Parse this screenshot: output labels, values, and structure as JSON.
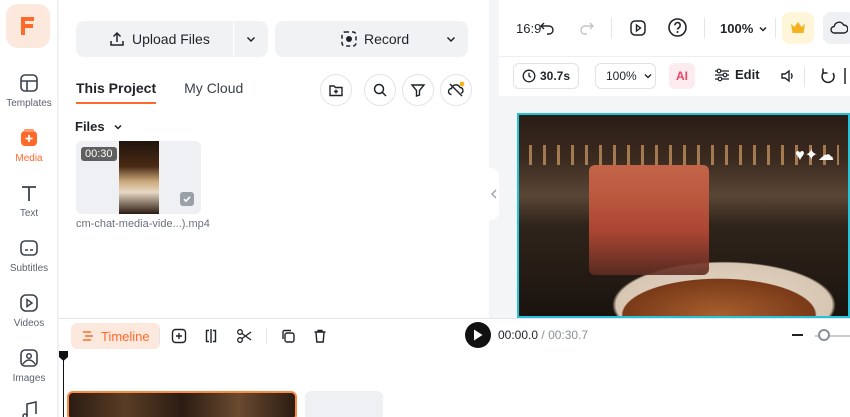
{
  "sidebar": {
    "items": [
      {
        "label": "Templates",
        "icon": "templates-icon"
      },
      {
        "label": "Media",
        "icon": "media-icon",
        "active": true
      },
      {
        "label": "Text",
        "icon": "text-icon"
      },
      {
        "label": "Subtitles",
        "icon": "subtitles-icon"
      },
      {
        "label": "Videos",
        "icon": "videos-icon"
      },
      {
        "label": "Images",
        "icon": "images-icon"
      }
    ]
  },
  "media": {
    "upload_label": "Upload Files",
    "record_label": "Record",
    "tabs": [
      "This Project",
      "My Cloud"
    ],
    "files_label": "Files",
    "file": {
      "duration": "00:30",
      "name": "cm-chat-media-vide...).mp4"
    }
  },
  "topbar": {
    "aspect": "16:9",
    "zoom": "100%"
  },
  "toolbar2": {
    "duration": "30.7s",
    "zoom": "100%",
    "ai_label": "AI",
    "edit_label": "Edit"
  },
  "timeline": {
    "label": "Timeline",
    "current_time": "00:00.0",
    "separator": " / ",
    "total_time": "00:30.7"
  },
  "colors": {
    "accent": "#ff6a2b",
    "preview_border": "#25c2d8"
  }
}
